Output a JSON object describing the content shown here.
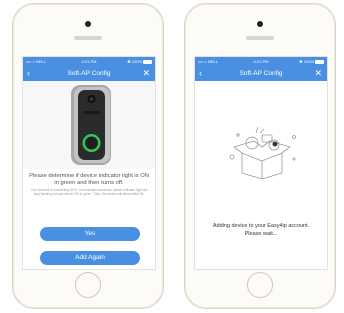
{
  "left_phone": {
    "status": {
      "carrier": "•••○○ BELL",
      "time": "4:21 PM",
      "battery": "100%"
    },
    "nav": {
      "title": "Soft-AP Config",
      "back_icon": "chevron-left-icon",
      "close_icon": "close-icon"
    },
    "instruction": "Please determine if device indicator light is ON in green and then turns off.",
    "note": "Your doorbell is connecting Wi-Fi. If connection succeeds, device indicator light will stop flashing red and will be ON in green. Then, the device will reboot after 5s.",
    "yes_label": "Yes",
    "add_again_label": "Add Again"
  },
  "right_phone": {
    "status": {
      "carrier": "•••○○ BELL",
      "time": "4:21 PM",
      "battery": "100%"
    },
    "nav": {
      "title": "Soft-AP Config",
      "back_icon": "chevron-left-icon",
      "close_icon": "close-icon"
    },
    "message_line1": "Adding device to your Easy4ip account.",
    "message_line2": "Please wait..."
  },
  "colors": {
    "accent": "#4a90e2",
    "indicator_ring": "#31c85a"
  }
}
